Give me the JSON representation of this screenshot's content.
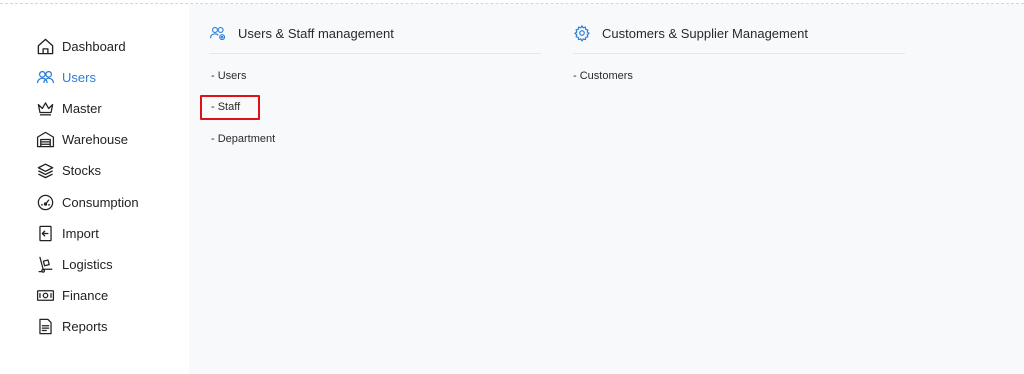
{
  "sidebar": {
    "items": [
      {
        "label": "Dashboard",
        "icon": "home-icon"
      },
      {
        "label": "Users",
        "icon": "users-icon",
        "active": true
      },
      {
        "label": "Master",
        "icon": "crown-icon"
      },
      {
        "label": "Warehouse",
        "icon": "warehouse-icon"
      },
      {
        "label": "Stocks",
        "icon": "layers-icon"
      },
      {
        "label": "Consumption",
        "icon": "gauge-icon"
      },
      {
        "label": "Import",
        "icon": "import-icon"
      },
      {
        "label": "Logistics",
        "icon": "hand-truck-icon"
      },
      {
        "label": "Finance",
        "icon": "banknote-icon"
      },
      {
        "label": "Reports",
        "icon": "document-icon"
      }
    ]
  },
  "sections": {
    "users_staff": {
      "title": "Users & Staff management",
      "icon": "users-settings-icon",
      "links": [
        "- Users",
        "- Staff",
        "- Department"
      ]
    },
    "customers_supplier": {
      "title": "Customers & Supplier Management",
      "icon": "gear-icon",
      "links": [
        "- Customers"
      ]
    }
  },
  "colors": {
    "accent": "#2f7fd6",
    "highlight": "#e0101b",
    "content_bg": "#f8f9fb"
  }
}
